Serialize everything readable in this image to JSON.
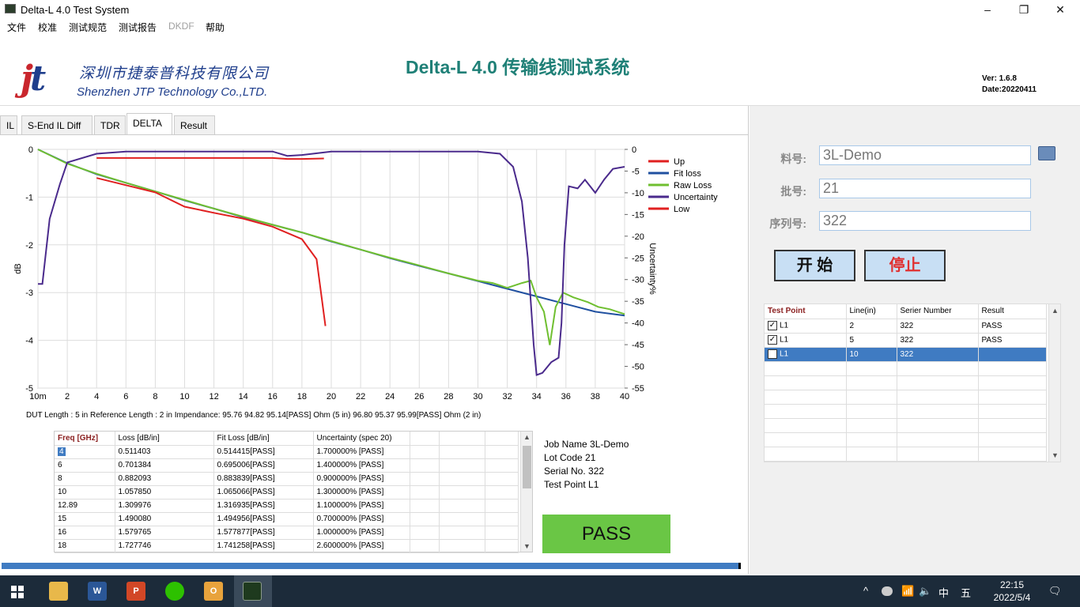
{
  "window": {
    "title": "Delta-L 4.0 Test System",
    "minimize_glyph": "–",
    "maximize_glyph": "❐",
    "close_glyph": "✕"
  },
  "menu": [
    "文件",
    "校准",
    "测试规范",
    "测试报告",
    "DKDF",
    "帮助"
  ],
  "header": {
    "logo_text": "jt",
    "company_cn": "深圳市捷泰普科技有限公司",
    "company_en": "Shenzhen JTP Technology Co.,LTD.",
    "app_title": "Delta-L 4.0 传输线测试系统",
    "version": "Ver: 1.6.8",
    "date": "Date:20220411"
  },
  "tabs": [
    "IL",
    "S-End IL Diff",
    "TDR",
    "DELTA",
    "Result"
  ],
  "chart_data": {
    "type": "line",
    "xlabel": "",
    "ylabel": "dB",
    "y2label": "Uncertainty%",
    "xlim": [
      0,
      40
    ],
    "ylim": [
      -5,
      0
    ],
    "y2lim": [
      -55,
      0
    ],
    "x_ticks": [
      "10m",
      "2",
      "4",
      "6",
      "8",
      "10",
      "12",
      "14",
      "16",
      "18",
      "20",
      "22",
      "24",
      "26",
      "28",
      "30",
      "32",
      "34",
      "36",
      "38",
      "40"
    ],
    "y_ticks": [
      "0",
      "-1",
      "-2",
      "-3",
      "-4",
      "-5"
    ],
    "y2_ticks": [
      "0",
      "-5",
      "-10",
      "-15",
      "-20",
      "-25",
      "-30",
      "-35",
      "-40",
      "-45",
      "-50",
      "-55"
    ],
    "legend_position": "top-right",
    "series": [
      {
        "name": "Up",
        "color": "#e02020",
        "axis": "left",
        "points": [
          [
            4,
            -0.18
          ],
          [
            10,
            -0.18
          ],
          [
            14,
            -0.18
          ],
          [
            16,
            -0.18
          ],
          [
            17,
            -0.2
          ],
          [
            18,
            -0.2
          ],
          [
            19.5,
            -0.19
          ]
        ]
      },
      {
        "name": "Fit loss",
        "color": "#2050a0",
        "axis": "left",
        "points": [
          [
            0,
            0
          ],
          [
            2,
            -0.29
          ],
          [
            4,
            -0.52
          ],
          [
            6,
            -0.7
          ],
          [
            8,
            -0.88
          ],
          [
            10,
            -1.07
          ],
          [
            12,
            -1.24
          ],
          [
            14,
            -1.42
          ],
          [
            16,
            -1.58
          ],
          [
            18,
            -1.74
          ],
          [
            20,
            -1.93
          ],
          [
            22,
            -2.1
          ],
          [
            24,
            -2.28
          ],
          [
            26,
            -2.44
          ],
          [
            28,
            -2.6
          ],
          [
            30,
            -2.76
          ],
          [
            32,
            -2.92
          ],
          [
            34,
            -3.08
          ],
          [
            36,
            -3.24
          ],
          [
            38,
            -3.4
          ],
          [
            40,
            -3.48
          ]
        ]
      },
      {
        "name": "Raw Loss",
        "color": "#6fbf30",
        "axis": "left",
        "points": [
          [
            0,
            0
          ],
          [
            2,
            -0.3
          ],
          [
            4,
            -0.51
          ],
          [
            6,
            -0.7
          ],
          [
            8,
            -0.88
          ],
          [
            10,
            -1.06
          ],
          [
            12,
            -1.24
          ],
          [
            14,
            -1.41
          ],
          [
            16,
            -1.58
          ],
          [
            18,
            -1.74
          ],
          [
            20,
            -1.92
          ],
          [
            22,
            -2.1
          ],
          [
            24,
            -2.27
          ],
          [
            26,
            -2.43
          ],
          [
            28,
            -2.6
          ],
          [
            30,
            -2.75
          ],
          [
            31,
            -2.8
          ],
          [
            32,
            -2.9
          ],
          [
            33,
            -2.8
          ],
          [
            33.6,
            -2.75
          ],
          [
            34,
            -3.1
          ],
          [
            34.5,
            -3.4
          ],
          [
            34.9,
            -4.1
          ],
          [
            35.3,
            -3.3
          ],
          [
            35.8,
            -3.0
          ],
          [
            36.5,
            -3.1
          ],
          [
            37.5,
            -3.2
          ],
          [
            38.2,
            -3.3
          ],
          [
            39,
            -3.35
          ],
          [
            40,
            -3.45
          ]
        ]
      },
      {
        "name": "Uncertainty",
        "color": "#4a2a8c",
        "axis": "right",
        "points": [
          [
            0,
            -31
          ],
          [
            0.3,
            -31
          ],
          [
            0.8,
            -16
          ],
          [
            1.5,
            -8
          ],
          [
            2,
            -3
          ],
          [
            4,
            -1
          ],
          [
            6,
            -0.5
          ],
          [
            10,
            -0.5
          ],
          [
            14,
            -0.5
          ],
          [
            16,
            -0.5
          ],
          [
            17,
            -1.5
          ],
          [
            18,
            -1.3
          ],
          [
            20,
            -0.5
          ],
          [
            24,
            -0.5
          ],
          [
            28,
            -0.5
          ],
          [
            30,
            -0.5
          ],
          [
            31.5,
            -1
          ],
          [
            32.4,
            -4
          ],
          [
            33,
            -12
          ],
          [
            33.4,
            -25
          ],
          [
            33.8,
            -45
          ],
          [
            34,
            -52
          ],
          [
            34.4,
            -51.5
          ],
          [
            35,
            -49
          ],
          [
            35.5,
            -48
          ],
          [
            35.7,
            -40
          ],
          [
            35.9,
            -22
          ],
          [
            36.2,
            -8.5
          ],
          [
            36.8,
            -9
          ],
          [
            37.3,
            -7
          ],
          [
            38,
            -10
          ],
          [
            38.6,
            -7
          ],
          [
            39.2,
            -4.5
          ],
          [
            40,
            -4
          ]
        ]
      },
      {
        "name": "Low",
        "color": "#e02020",
        "axis": "left",
        "points": [
          [
            4,
            -0.6
          ],
          [
            6,
            -0.75
          ],
          [
            8,
            -0.9
          ],
          [
            10,
            -1.2
          ],
          [
            12,
            -1.33
          ],
          [
            14,
            -1.45
          ],
          [
            16,
            -1.62
          ],
          [
            18,
            -1.88
          ],
          [
            19,
            -2.3
          ],
          [
            19.6,
            -3.7
          ]
        ]
      }
    ]
  },
  "info_line": "DUT Length : 5 in   Reference Length : 2 in    Impendance: 95.76 94.82 95.14[PASS] Ohm (5 in)  96.80 95.37 95.99[PASS] Ohm (2 in)",
  "freq_table": {
    "columns": [
      "Freq [GHz]",
      "Loss [dB/in]",
      "Fit Loss [dB/in]",
      "Uncertainty (spec 20)"
    ],
    "rows": [
      [
        "4",
        "0.511403",
        "0.514415[PASS]",
        "1.700000% [PASS]"
      ],
      [
        "6",
        "0.701384",
        "0.695006[PASS]",
        "1.400000% [PASS]"
      ],
      [
        "8",
        "0.882093",
        "0.883839[PASS]",
        "0.900000% [PASS]"
      ],
      [
        "10",
        "1.057850",
        "1.065066[PASS]",
        "1.300000% [PASS]"
      ],
      [
        "12.89",
        "1.309976",
        "1.316935[PASS]",
        "1.100000% [PASS]"
      ],
      [
        "15",
        "1.490080",
        "1.494956[PASS]",
        "0.700000% [PASS]"
      ],
      [
        "16",
        "1.579765",
        "1.577877[PASS]",
        "1.000000% [PASS]"
      ],
      [
        "18",
        "1.727746",
        "1.741258[PASS]",
        "2.600000% [PASS]"
      ]
    ]
  },
  "job": {
    "name": "Job Name  3L-Demo",
    "lot": "Lot Code 21",
    "serial": "Serial No. 322",
    "test_point": "Test Point L1"
  },
  "result_badge": "PASS",
  "form": {
    "part_label": "料号:",
    "part_value": "3L-Demo",
    "lot_label": "批号:",
    "lot_value": "21",
    "serial_label": "序列号:",
    "serial_value": "322",
    "start_label": "开 始",
    "stop_label": "停止"
  },
  "testpoint_table": {
    "columns": [
      "Test Point",
      "Line(in)",
      "Serier Number",
      "Result"
    ],
    "rows": [
      {
        "checked": true,
        "point": "L1",
        "line": "2",
        "serial": "322",
        "result": "PASS"
      },
      {
        "checked": true,
        "point": "L1",
        "line": "5",
        "serial": "322",
        "result": "PASS"
      },
      {
        "checked": false,
        "point": "L1",
        "line": "10",
        "serial": "322",
        "result": "",
        "selected": true
      }
    ]
  },
  "taskbar": {
    "apps": [
      "start-icon",
      "file-explorer-icon",
      "word-icon",
      "powerpoint-icon",
      "wechat-icon",
      "outlook-icon",
      "delta-l-app-icon"
    ],
    "ime": "中",
    "ime_mode": "五",
    "time": "22:15",
    "date": "2022/5/4"
  }
}
